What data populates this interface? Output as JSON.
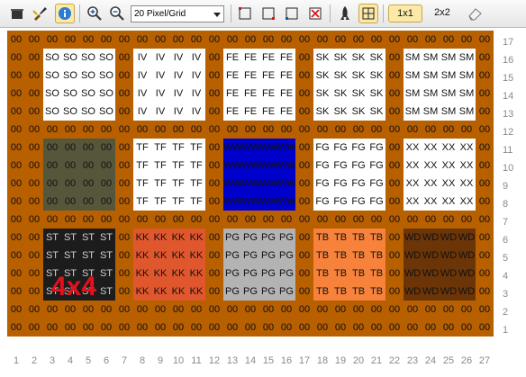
{
  "toolbar": {
    "zoom_value": "20 Pixel/Grid",
    "view_1x1_label": "1x1",
    "view_2x2_label": "2x2",
    "buttons": [
      {
        "name": "open-icon",
        "active": false
      },
      {
        "name": "brush-icon",
        "active": false
      },
      {
        "name": "info-icon",
        "active": true
      },
      {
        "name": "zoom-in-icon",
        "active": false
      },
      {
        "name": "zoom-out-icon",
        "active": false
      },
      {
        "name": "select-tl-icon",
        "active": false
      },
      {
        "name": "select-br-icon",
        "active": false
      },
      {
        "name": "select-bl-icon",
        "active": false
      },
      {
        "name": "delete-selection-icon",
        "active": false
      },
      {
        "name": "rocket-icon",
        "active": false
      },
      {
        "name": "grid-toggle-icon",
        "active": true
      },
      {
        "name": "eraser-icon",
        "active": false
      }
    ]
  },
  "grid": {
    "background": "#b85f00",
    "default_code": "00",
    "cols": 27,
    "rows": 17,
    "blocks": [
      {
        "name": "so",
        "code": "SO",
        "color": "#ffffff",
        "text_color": "#111111",
        "row": 1,
        "col": 2
      },
      {
        "name": "iv",
        "code": "IV",
        "color": "#ffffff",
        "text_color": "#111111",
        "row": 1,
        "col": 7
      },
      {
        "name": "fe",
        "code": "FE",
        "color": "#ffffff",
        "text_color": "#111111",
        "row": 1,
        "col": 12
      },
      {
        "name": "sk",
        "code": "SK",
        "color": "#ffffff",
        "text_color": "#111111",
        "row": 1,
        "col": 17
      },
      {
        "name": "sm",
        "code": "SM",
        "color": "#ffffff",
        "text_color": "#111111",
        "row": 1,
        "col": 22
      },
      {
        "name": "empty-olive",
        "code": "00",
        "color": "#56573a",
        "text_color": "#111111",
        "row": 6,
        "col": 2
      },
      {
        "name": "tf",
        "code": "TF",
        "color": "#ffffff",
        "text_color": "#111111",
        "row": 6,
        "col": 7
      },
      {
        "name": "ww",
        "code": "WW",
        "color": "#0000cc",
        "text_color": "#111111",
        "row": 6,
        "col": 12
      },
      {
        "name": "fg",
        "code": "FG",
        "color": "#ffffff",
        "text_color": "#111111",
        "row": 6,
        "col": 17
      },
      {
        "name": "xx",
        "code": "XX",
        "color": "#ffffff",
        "text_color": "#111111",
        "row": 6,
        "col": 22
      },
      {
        "name": "st",
        "code": "ST",
        "color": "#1c1c1c",
        "text_color": "#cfcfcf",
        "row": 11,
        "col": 2
      },
      {
        "name": "kk",
        "code": "KK",
        "color": "#e0572e",
        "text_color": "#111111",
        "row": 11,
        "col": 7
      },
      {
        "name": "pg",
        "code": "PG",
        "color": "#b3b3b3",
        "text_color": "#111111",
        "row": 11,
        "col": 12
      },
      {
        "name": "tb",
        "code": "TB",
        "color": "#f7823c",
        "text_color": "#111111",
        "row": 11,
        "col": 17
      },
      {
        "name": "wd",
        "code": "WD",
        "color": "#6b3508",
        "text_color": "#111111",
        "row": 11,
        "col": 22
      }
    ],
    "overlay_label": "4x4"
  },
  "y_labels": [
    "17",
    "16",
    "15",
    "14",
    "13",
    "12",
    "11",
    "10",
    "9",
    "8",
    "7",
    "6",
    "5",
    "4",
    "3",
    "2",
    "1"
  ],
  "x_labels": [
    "1",
    "2",
    "3",
    "4",
    "5",
    "6",
    "7",
    "8",
    "9",
    "10",
    "11",
    "12",
    "13",
    "14",
    "15",
    "16",
    "17",
    "18",
    "19",
    "20",
    "21",
    "22",
    "23",
    "24",
    "25",
    "26",
    "27"
  ]
}
